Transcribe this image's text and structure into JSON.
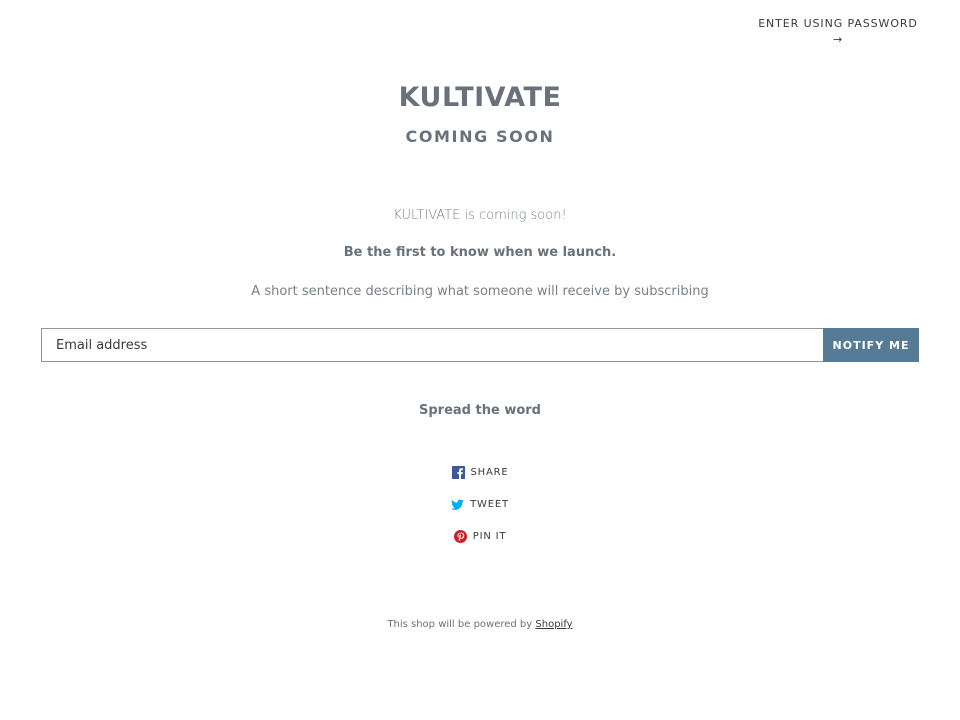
{
  "header": {
    "password_link_label": "ENTER USING PASSWORD",
    "password_link_arrow": "→"
  },
  "hero": {
    "brand": "KULTIVATE",
    "subtitle": "COMING SOON"
  },
  "content": {
    "coming_text": "KULTIVATE is coming soon!",
    "launch_text": "Be the first to know when we launch.",
    "description": "A short sentence describing what someone will receive by subscribing"
  },
  "signup": {
    "email_placeholder": "Email address",
    "button_label": "NOTIFY ME",
    "button_color": "#557b97"
  },
  "social": {
    "heading": "Spread the word",
    "items": [
      {
        "label": "SHARE",
        "icon": "facebook-icon",
        "color": "#3b5998"
      },
      {
        "label": "TWEET",
        "icon": "twitter-icon",
        "color": "#00aced"
      },
      {
        "label": "PIN IT",
        "icon": "pinterest-icon",
        "color": "#cb2027"
      }
    ]
  },
  "footer": {
    "text": "This shop will be powered by",
    "link_label": "Shopify"
  }
}
